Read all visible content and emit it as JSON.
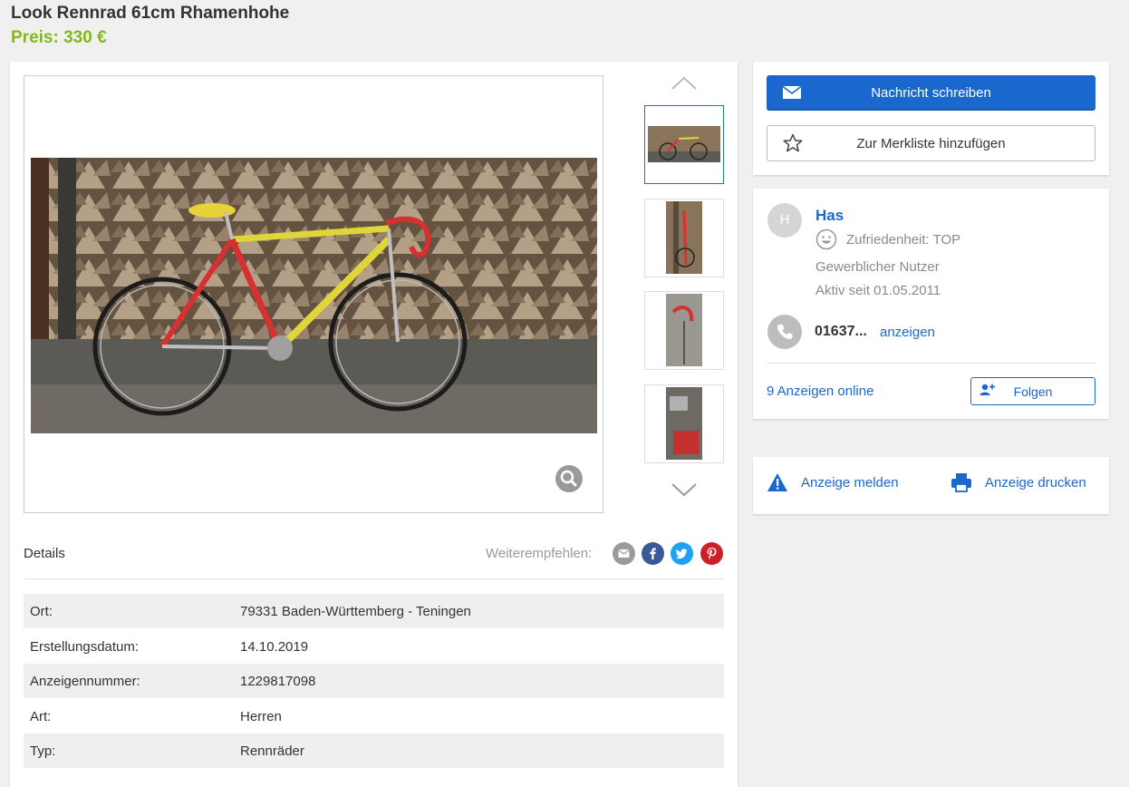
{
  "listing": {
    "title": "Look Rennrad 61cm Rhamenhohe",
    "price": "Preis: 330 €"
  },
  "gallery": {
    "thumbnails": [
      {
        "icon": "bike-photo-thumb-1",
        "active": true
      },
      {
        "icon": "bike-photo-thumb-2",
        "active": false
      },
      {
        "icon": "bike-photo-thumb-3",
        "active": false
      },
      {
        "icon": "bike-photo-thumb-4",
        "active": false
      }
    ],
    "zoom_icon": "magnifier-icon",
    "up_icon": "chevron-up-icon",
    "down_icon": "chevron-down-icon"
  },
  "details": {
    "heading": "Details",
    "share_label": "Weiterempfehlen:",
    "share_icons": [
      "email-icon",
      "facebook-icon",
      "twitter-icon",
      "pinterest-icon"
    ],
    "rows": [
      {
        "key": "Ort:",
        "value": "79331 Baden-Württemberg - Teningen"
      },
      {
        "key": "Erstellungsdatum:",
        "value": "14.10.2019"
      },
      {
        "key": "Anzeigennummer:",
        "value": "1229817098"
      },
      {
        "key": "Art:",
        "value": "Herren"
      },
      {
        "key": "Typ:",
        "value": "Rennräder"
      }
    ]
  },
  "actions": {
    "message_label": "Nachricht schreiben",
    "watchlist_label": "Zur Merkliste hinzufügen"
  },
  "seller": {
    "avatar_letter": "H",
    "name": "Has",
    "rating": "Zufriedenheit: TOP",
    "type": "Gewerblicher Nutzer",
    "active_since": "Aktiv seit 01.05.2011",
    "phone_partial": "01637...",
    "phone_show": "anzeigen",
    "ads_online": "9 Anzeigen online",
    "follow_label": "Folgen"
  },
  "report": {
    "report_label": "Anzeige melden",
    "print_label": "Anzeige drucken"
  },
  "colors": {
    "accent": "#1a68cd",
    "price": "#86b817",
    "facebook": "#3b5998",
    "twitter": "#1da1f2",
    "pinterest": "#cb2027"
  }
}
